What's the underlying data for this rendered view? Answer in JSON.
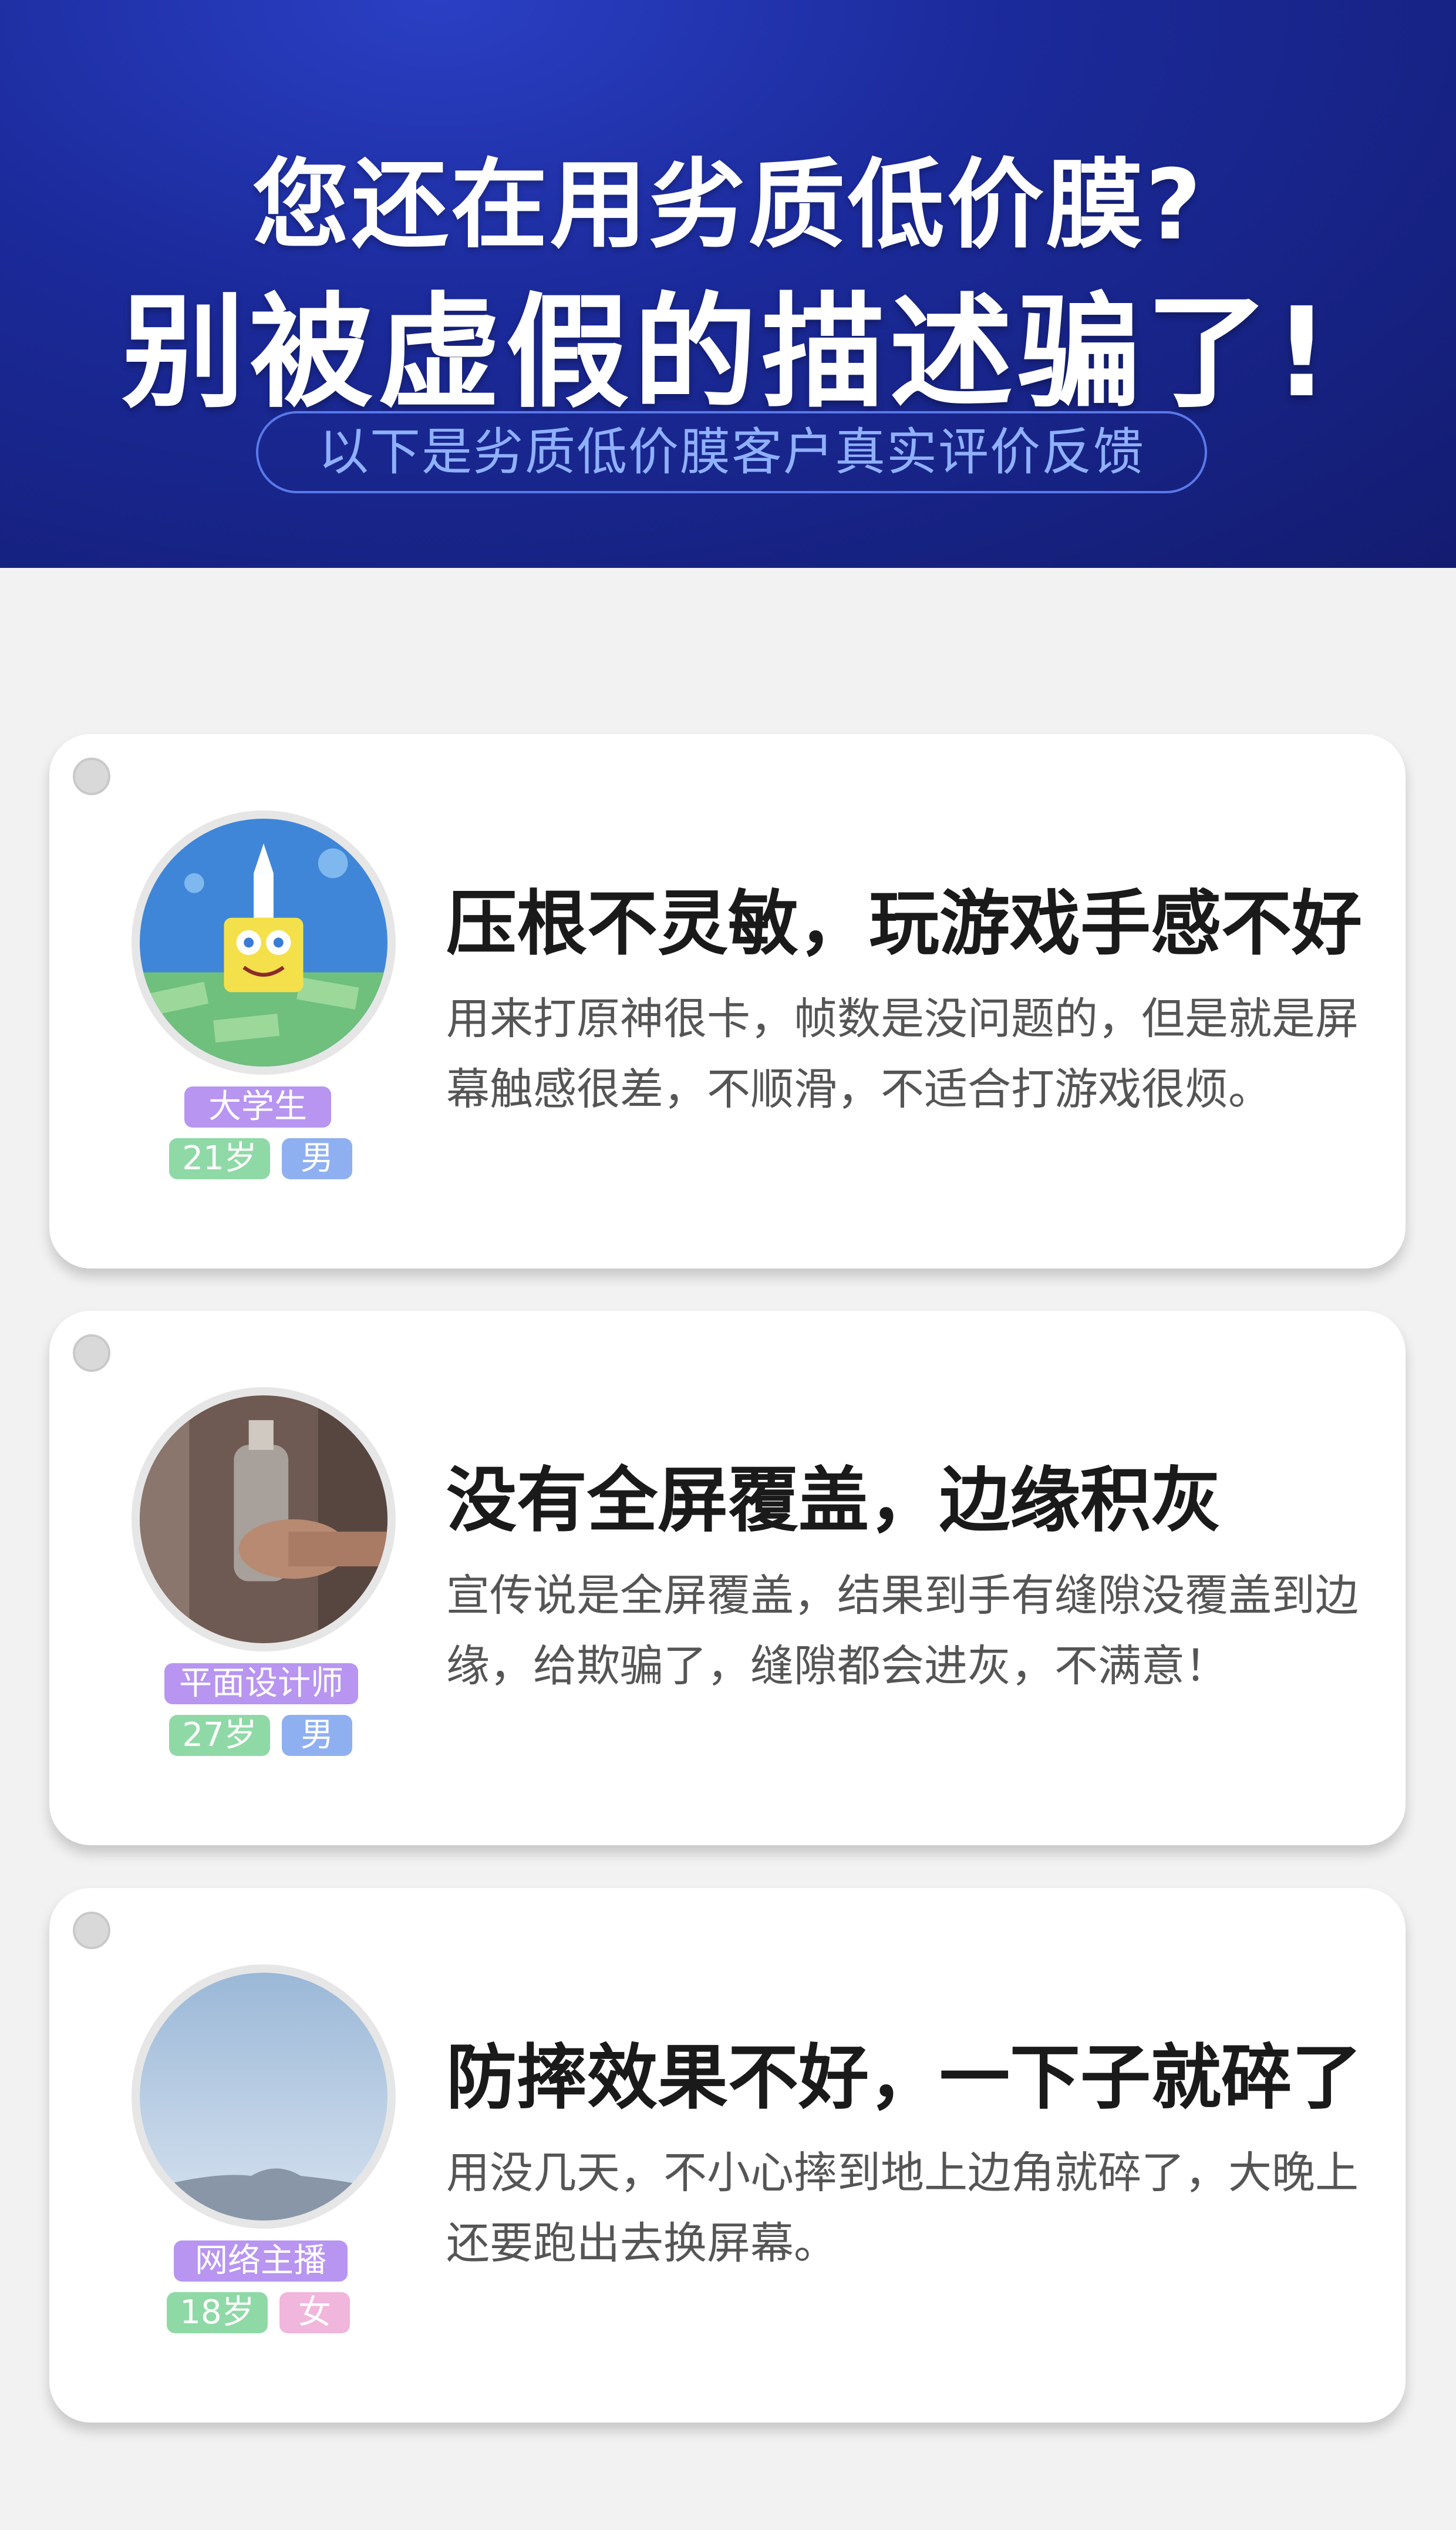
{
  "header": {
    "title_line1": "您还在用劣质低价膜?",
    "title_line2": "别被虚假的描述骗了!",
    "subtitle": "以下是劣质低价膜客户真实评价反馈"
  },
  "reviews": [
    {
      "role": "大学生",
      "age": "21岁",
      "gender": "男",
      "title": "压根不灵敏，玩游戏手感不好",
      "body": "用来打原神很卡，帧数是没问题的，但是就是屏幕触感很差，不顺滑，不适合打游戏很烦。",
      "avatar": "spongebob-avatar"
    },
    {
      "role": "平面设计师",
      "age": "27岁",
      "gender": "男",
      "title": "没有全屏覆盖，边缘积灰",
      "body": "宣传说是全屏覆盖，结果到手有缝隙没覆盖到边缘，给欺骗了，缝隙都会进灰，不满意！",
      "avatar": "hand-bottle-avatar"
    },
    {
      "role": "网络主播",
      "age": "18岁",
      "gender": "女",
      "title": "防摔效果不好，一下子就碎了",
      "body": "用没几天，不小心摔到地上边角就碎了，大晚上还要跑出去换屏幕。",
      "avatar": "sky-mountain-avatar"
    }
  ],
  "colors": {
    "header_bg": "#1b2a9a",
    "role_tag": "#b795f0",
    "age_tag": "#8fd9a6",
    "male_tag": "#8fb0f0",
    "female_tag": "#f0b6dc"
  }
}
